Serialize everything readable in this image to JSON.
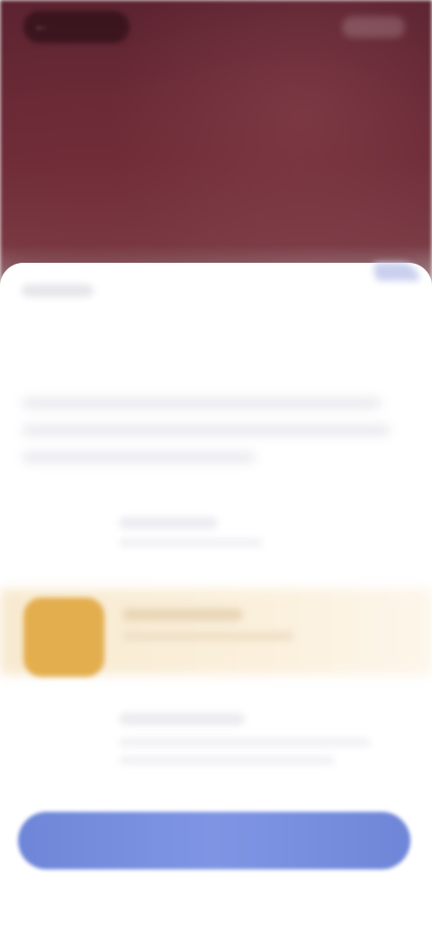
{
  "header": {
    "back_icon": "arrow-left-icon"
  },
  "sheet": {
    "title": "",
    "description": ""
  },
  "options": [
    {
      "title": "",
      "subtitle": "",
      "highlighted": false
    },
    {
      "title": "",
      "subtitle": "",
      "highlighted": true,
      "icon_color": "#e3ae4e"
    },
    {
      "title": "",
      "subtitle": "",
      "highlighted": false
    }
  ],
  "primary_button": {
    "label": "",
    "color": "#7689dc"
  }
}
